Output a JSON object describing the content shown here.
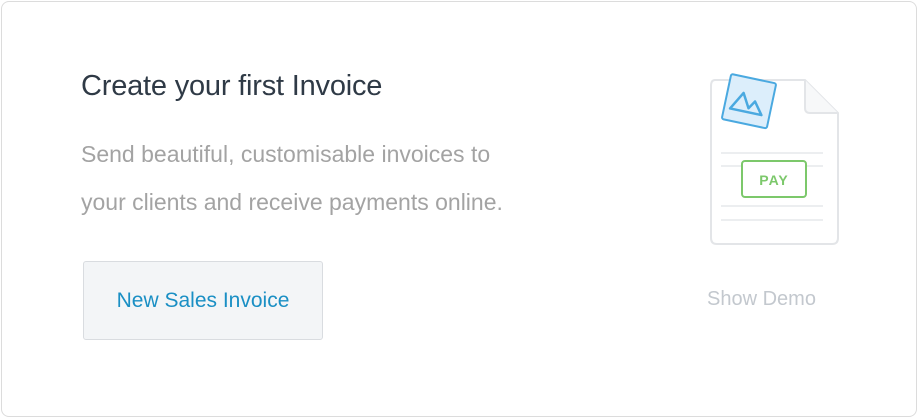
{
  "empty_state": {
    "title": "Create your first Invoice",
    "description_line1": "Send beautiful, customisable invoices to",
    "description_line2": "your clients and receive payments online.",
    "primary_button_label": "New Sales Invoice",
    "demo_link_label": "Show Demo",
    "illustration": {
      "icon": "invoice-document-icon",
      "badge_text": "PAY"
    }
  },
  "colors": {
    "title": "#2f3a46",
    "body_text": "#a3a3a3",
    "link_blue": "#1a8fc4",
    "button_bg": "#f3f5f7",
    "muted_link": "#c3c8ce",
    "pay_green": "#7cc86b",
    "logo_blue": "#4aa9e0"
  }
}
